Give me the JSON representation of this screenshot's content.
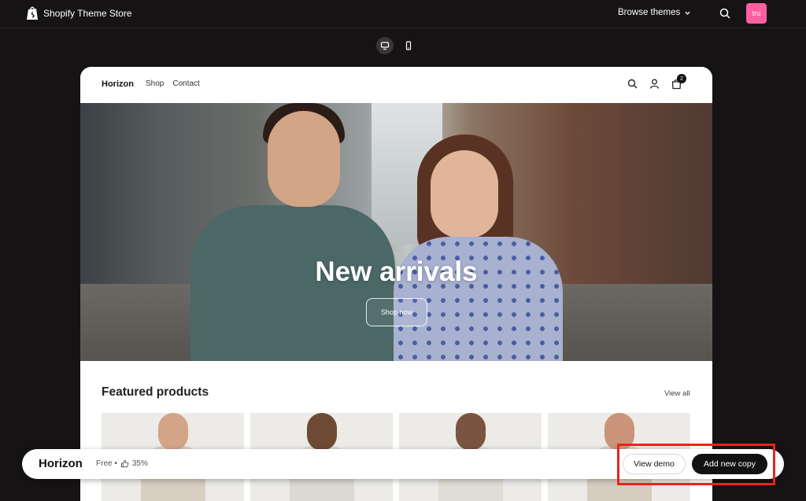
{
  "topbar": {
    "brand": "Shopify Theme Store",
    "browse_label": "Browse themes",
    "avatar_initials": "tru"
  },
  "store": {
    "logo": "Horizon",
    "nav": [
      "Shop",
      "Contact"
    ],
    "cart_count": "2",
    "hero_title": "New arrivals",
    "hero_button": "Shop now",
    "featured_title": "Featured products",
    "view_all": "View all"
  },
  "bottom_bar": {
    "theme_name": "Horizon",
    "price": "Free •",
    "rating": "35%",
    "view_demo": "View demo",
    "add_copy": "Add new copy"
  },
  "colors": {
    "avatar_bg": "#ff5fa2",
    "highlight": "#e6251b",
    "page_bg": "#161314"
  }
}
